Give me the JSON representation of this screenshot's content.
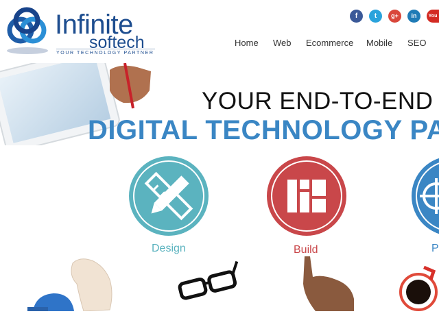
{
  "brand": {
    "name_primary": "Infinite",
    "name_secondary": "softech",
    "tagline": "YOUR TECHNOLOGY PARTNER",
    "color": "#1d4d8f"
  },
  "social": [
    {
      "icon": "facebook-icon",
      "glyph": "f",
      "color": "#3b5998"
    },
    {
      "icon": "twitter-icon",
      "glyph": "t",
      "color": "#2aa3dc"
    },
    {
      "icon": "google-plus-icon",
      "glyph": "g+",
      "color": "#d9473b"
    },
    {
      "icon": "linkedin-icon",
      "glyph": "in",
      "color": "#1f7bb6"
    },
    {
      "icon": "youtube-icon",
      "glyph": "You",
      "color": "#d32b23"
    }
  ],
  "nav": [
    {
      "label": "Home"
    },
    {
      "label": "Web"
    },
    {
      "label": "Ecommerce"
    },
    {
      "label": "Mobile"
    },
    {
      "label": "SEO"
    }
  ],
  "hero": {
    "headline_line1": "YOUR END-TO-END",
    "headline_line2": "DIGITAL TECHNOLOGY PA",
    "headline_color": "#3a86c4"
  },
  "services": [
    {
      "label": "Design",
      "icon": "pencil-ruler-icon",
      "color": "#5bb3bf"
    },
    {
      "label": "Build",
      "icon": "layout-blocks-icon",
      "color": "#c9474a"
    },
    {
      "label": "P",
      "icon": "gear-icon",
      "color": "#3a86c4"
    }
  ]
}
